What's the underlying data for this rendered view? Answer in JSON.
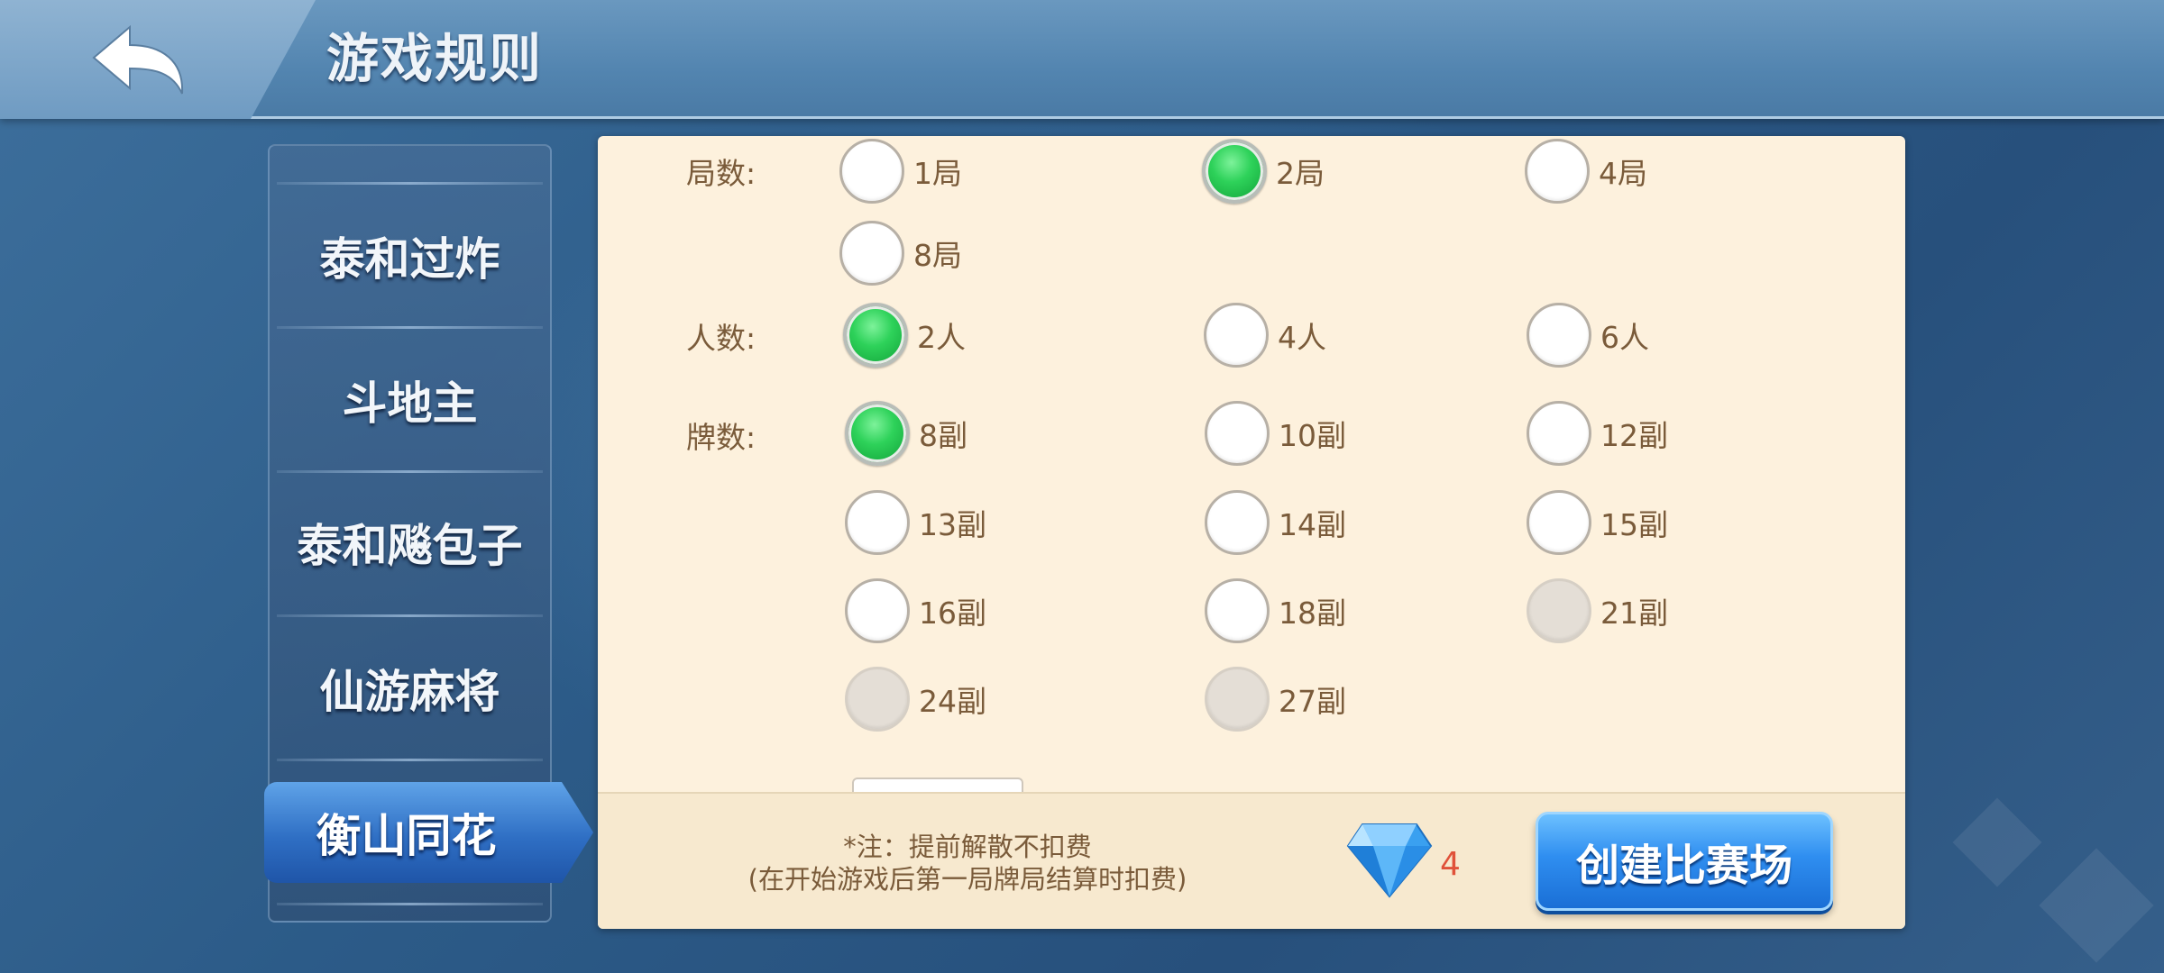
{
  "header": {
    "title": "游戏规则",
    "back_icon": "back-arrow-icon"
  },
  "sidebar": {
    "items": [
      {
        "label": "泰和过炸",
        "active": false
      },
      {
        "label": "斗地主",
        "active": false
      },
      {
        "label": "泰和飚包子",
        "active": false
      },
      {
        "label": "仙游麻将",
        "active": false
      },
      {
        "label": "衡山同花",
        "active": true
      }
    ]
  },
  "rules": {
    "rounds": {
      "label": "局数:",
      "options": [
        {
          "label": "1局",
          "selected": false,
          "disabled": false
        },
        {
          "label": "2局",
          "selected": true,
          "disabled": false
        },
        {
          "label": "4局",
          "selected": false,
          "disabled": false
        },
        {
          "label": "8局",
          "selected": false,
          "disabled": false
        }
      ]
    },
    "players": {
      "label": "人数:",
      "options": [
        {
          "label": "2人",
          "selected": true,
          "disabled": false
        },
        {
          "label": "4人",
          "selected": false,
          "disabled": false
        },
        {
          "label": "6人",
          "selected": false,
          "disabled": false
        }
      ]
    },
    "decks": {
      "label": "牌数:",
      "options": [
        {
          "label": "8副",
          "selected": true,
          "disabled": false
        },
        {
          "label": "10副",
          "selected": false,
          "disabled": false
        },
        {
          "label": "12副",
          "selected": false,
          "disabled": false
        },
        {
          "label": "13副",
          "selected": false,
          "disabled": false
        },
        {
          "label": "14副",
          "selected": false,
          "disabled": false
        },
        {
          "label": "15副",
          "selected": false,
          "disabled": false
        },
        {
          "label": "16副",
          "selected": false,
          "disabled": false
        },
        {
          "label": "18副",
          "selected": false,
          "disabled": false
        },
        {
          "label": "21副",
          "selected": false,
          "disabled": true
        },
        {
          "label": "24副",
          "selected": false,
          "disabled": true
        },
        {
          "label": "27副",
          "selected": false,
          "disabled": true
        }
      ]
    }
  },
  "footer": {
    "note_line1": "*注：提前解散不扣费",
    "note_line2": "(在开始游戏后第一局牌局结算时扣费)",
    "gem_icon": "diamond-gem-icon",
    "cost": "4",
    "create_button": "创建比赛场"
  },
  "colors": {
    "panel_bg": "#fdf1dd",
    "text_brown": "#7a5b3a",
    "radio_selected": "#2ed25a",
    "cost_red": "#e0523a",
    "button_blue": "#2f8ef0"
  }
}
